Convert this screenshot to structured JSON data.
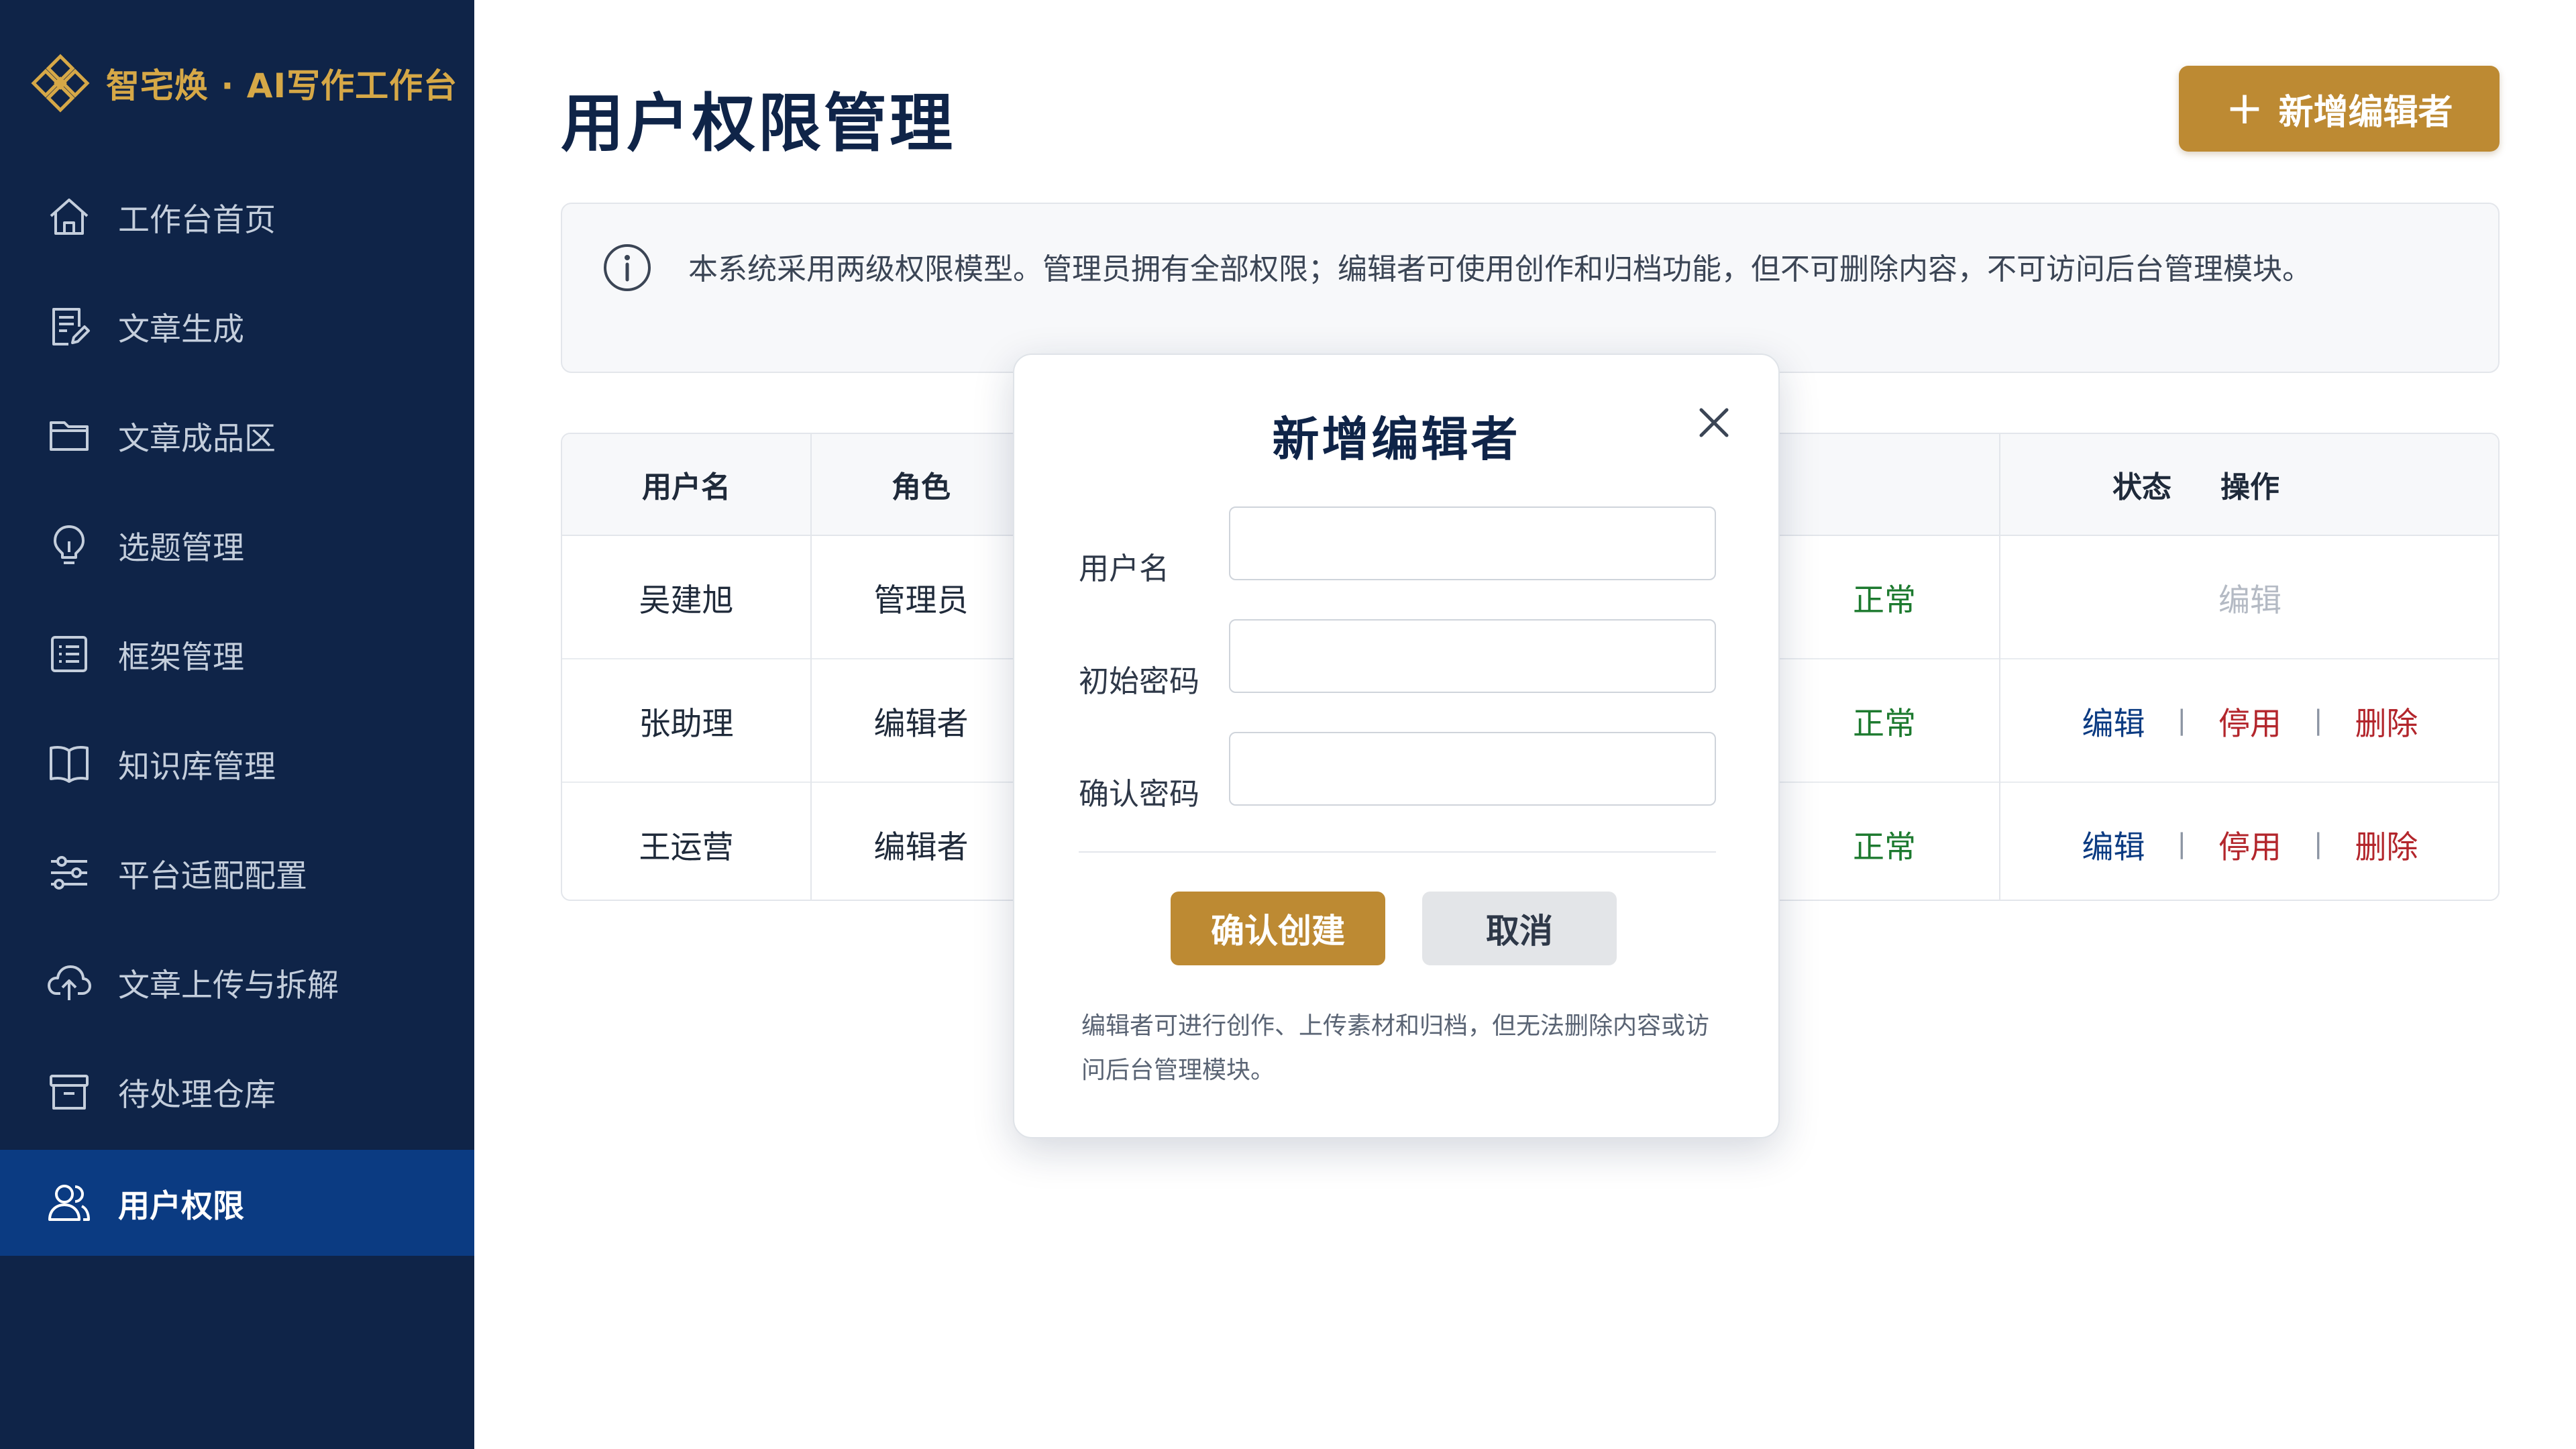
{
  "brand": {
    "name": "智宅焕 · AI写作工作台",
    "accent_color": "#d6a847"
  },
  "sidebar": {
    "items": [
      {
        "label": "工作台首页",
        "icon": "home-icon"
      },
      {
        "label": "文章生成",
        "icon": "document-edit-icon"
      },
      {
        "label": "文章成品区",
        "icon": "folder-icon"
      },
      {
        "label": "选题管理",
        "icon": "lightbulb-icon"
      },
      {
        "label": "框架管理",
        "icon": "list-icon"
      },
      {
        "label": "知识库管理",
        "icon": "book-icon"
      },
      {
        "label": "平台适配配置",
        "icon": "sliders-icon"
      },
      {
        "label": "文章上传与拆解",
        "icon": "cloud-upload-icon"
      },
      {
        "label": "待处理仓库",
        "icon": "archive-box-icon"
      },
      {
        "label": "用户权限",
        "icon": "users-icon",
        "active": true
      }
    ]
  },
  "page": {
    "title": "用户权限管理",
    "add_button": "新增编辑者",
    "notice": "本系统采用两级权限模型。管理员拥有全部权限；编辑者可使用创作和归档功能，但不可删除内容，不可访问后台管理模块。"
  },
  "table": {
    "headers": {
      "username": "用户名",
      "role": "角色",
      "status": "状态",
      "actions": "操作"
    },
    "rows": [
      {
        "username": "吴建旭",
        "role": "管理员",
        "status": "正常",
        "edit": "编辑"
      },
      {
        "username": "张助理",
        "role": "编辑者",
        "status": "正常",
        "edit": "编辑",
        "disable": "停用",
        "delete": "删除"
      },
      {
        "username": "王运营",
        "role": "编辑者",
        "status": "正常",
        "edit": "编辑",
        "disable": "停用",
        "delete": "删除"
      }
    ],
    "separator": "|"
  },
  "modal": {
    "title": "新增编辑者",
    "fields": {
      "username": {
        "label": "用户名",
        "value": ""
      },
      "password": {
        "label": "初始密码",
        "value": ""
      },
      "confirm_password": {
        "label": "确认密码",
        "value": ""
      }
    },
    "confirm_button": "确认创建",
    "cancel_button": "取消",
    "note": "编辑者可进行创作、上传素材和归档，但无法删除内容或访问后台管理模块。"
  },
  "colors": {
    "sidebar_bg": "#0f2448",
    "sidebar_active": "#0b3b82",
    "gold": "#bd8a33",
    "status_green": "#1d7a2f",
    "danger_red": "#b3262c",
    "link_blue": "#0b3b82"
  }
}
